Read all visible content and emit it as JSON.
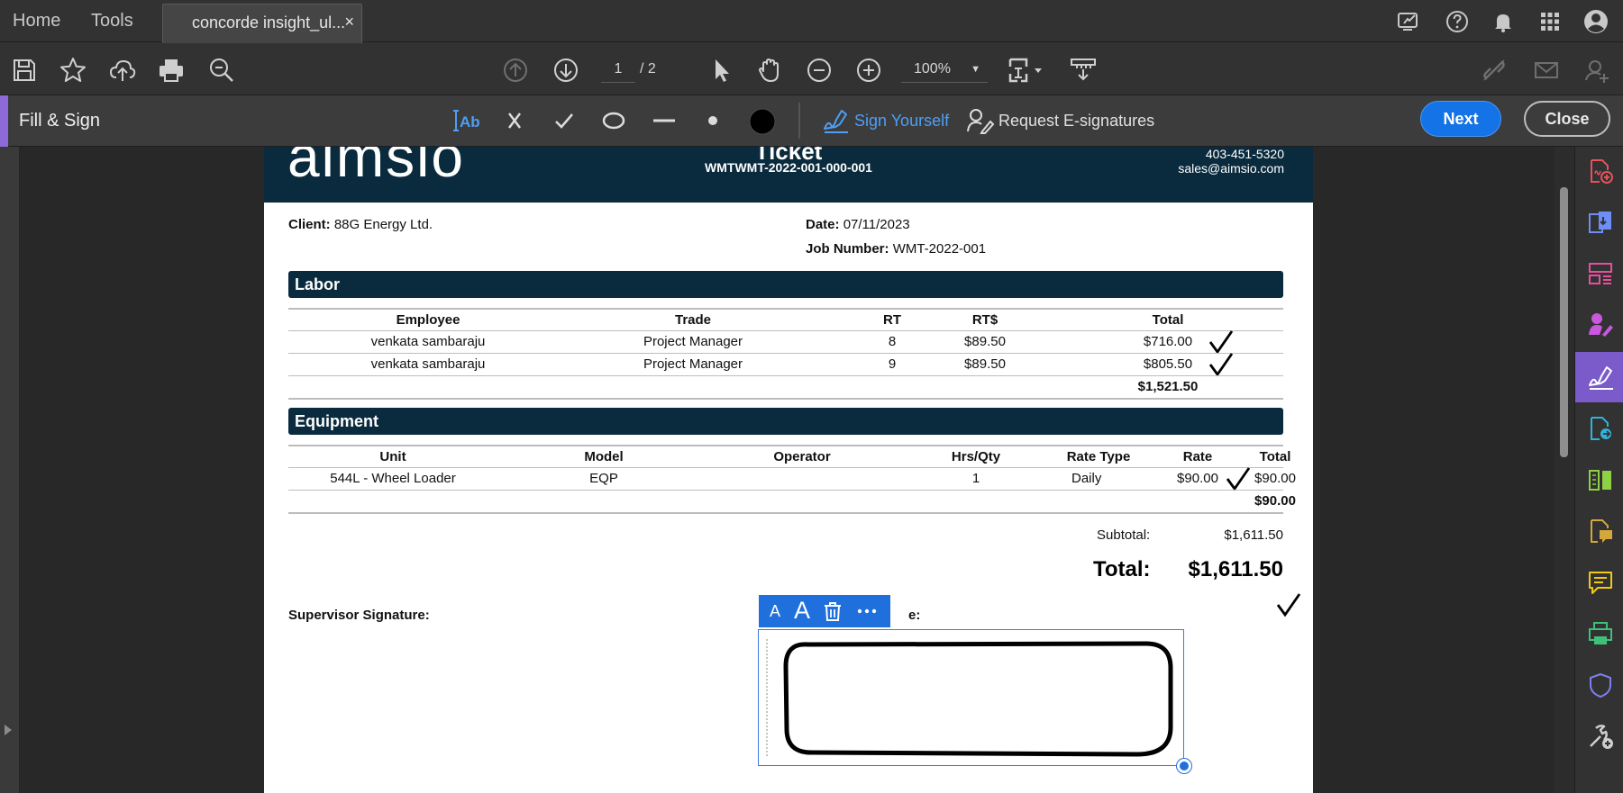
{
  "tabs": {
    "home": "Home",
    "tools": "Tools",
    "document": "concorde insight_ul...",
    "close": "×"
  },
  "toolbar": {
    "page_current": "1",
    "page_total": "/ 2",
    "zoom": "100%"
  },
  "fill_sign": {
    "title": "Fill & Sign",
    "sign_yourself": "Sign Yourself",
    "request_esignatures": "Request E-signatures",
    "next": "Next",
    "close": "Close"
  },
  "document": {
    "logo": "aimsio",
    "title": "Ticket",
    "ticket_id": "WMTWMT-2022-001-000-001",
    "phone": "403-451-5320",
    "email": "sales@aimsio.com",
    "client_label": "Client:",
    "client_value": "88G Energy Ltd.",
    "date_label": "Date:",
    "date_value": "07/11/2023",
    "job_label": "Job Number:",
    "job_value": "WMT-2022-001",
    "labor": {
      "title": "Labor",
      "headers": [
        "Employee",
        "Trade",
        "RT",
        "RT$",
        "Total"
      ],
      "rows": [
        [
          "venkata sambaraju",
          "Project Manager",
          "8",
          "$89.50",
          "$716.00"
        ],
        [
          "venkata sambaraju",
          "Project Manager",
          "9",
          "$89.50",
          "$805.50"
        ]
      ],
      "total": "$1,521.50"
    },
    "equipment": {
      "title": "Equipment",
      "headers": [
        "Unit",
        "Model",
        "Operator",
        "Hrs/Qty",
        "Rate Type",
        "Rate",
        "Total"
      ],
      "rows": [
        [
          "544L - Wheel Loader",
          "EQP",
          "",
          "1",
          "Daily",
          "$90.00",
          "$90.00"
        ]
      ],
      "total": "$90.00"
    },
    "subtotal_label": "Subtotal:",
    "subtotal_value": "$1,611.50",
    "total_label": "Total:",
    "total_value": "$1,611.50",
    "supervisor_signature": "Supervisor Signature:",
    "second_signature_fragment": "e:"
  },
  "signature_toolbar": {
    "smaller": "A",
    "larger": "A"
  }
}
